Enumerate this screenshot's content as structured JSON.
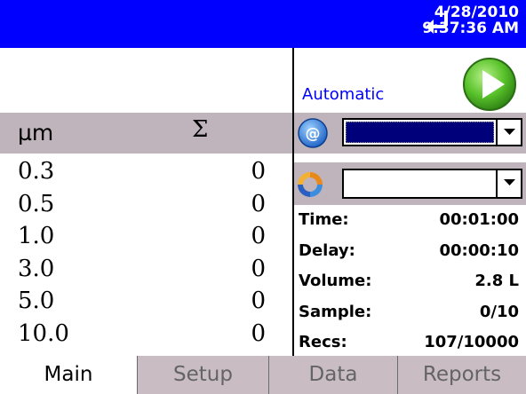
{
  "header": {
    "date": "4/28/2010",
    "time": "9:37:36 AM",
    "status_icon": "enter-arrow-icon",
    "background_color": "#0000ff"
  },
  "table": {
    "col_size": "µm",
    "col_count": "Σ",
    "rows": [
      {
        "size": "0.3",
        "count": "0"
      },
      {
        "size": "0.5",
        "count": "0"
      },
      {
        "size": "1.0",
        "count": "0"
      },
      {
        "size": "3.0",
        "count": "0"
      },
      {
        "size": "5.0",
        "count": "0"
      },
      {
        "size": "10.0",
        "count": "0"
      }
    ]
  },
  "control": {
    "mode_label": "Automatic",
    "play_icon": "play-icon",
    "location_icon": "at-icon",
    "location_value": "",
    "cycle_icon": "cycle-icon",
    "cycle_value": ""
  },
  "info": [
    {
      "key": "Time:",
      "value": "00:01:00"
    },
    {
      "key": "Delay:",
      "value": "00:00:10"
    },
    {
      "key": "Volume:",
      "value": "2.8 L"
    },
    {
      "key": "Sample:",
      "value": "0/10"
    },
    {
      "key": "Recs:",
      "value": "107/10000"
    }
  ],
  "tabs": [
    {
      "label": "Main",
      "active": true
    },
    {
      "label": "Setup",
      "active": false
    },
    {
      "label": "Data",
      "active": false
    },
    {
      "label": "Reports",
      "active": false
    }
  ],
  "colors": {
    "header_blue": "#0000ff",
    "header_row_gray": "#bfb4bb",
    "tab_gray": "#c9bcc3",
    "selection_navy": "#00007b",
    "mode_text": "#0000ff"
  }
}
